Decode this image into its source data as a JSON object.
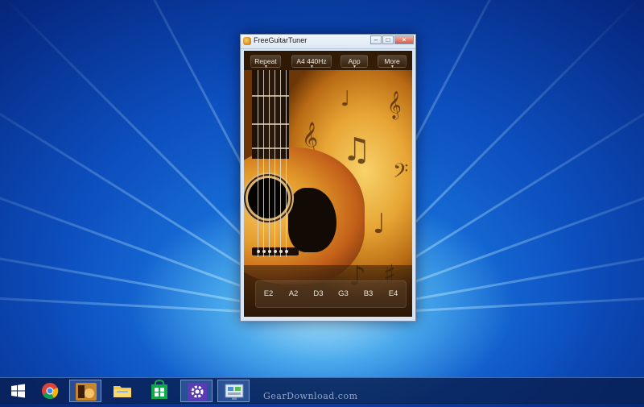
{
  "window": {
    "title": "FreeGuitarTuner"
  },
  "toolbar": {
    "repeat": "Repeat",
    "pitch": "A4 440Hz",
    "app": "App",
    "more": "More"
  },
  "strings": [
    "E2",
    "A2",
    "D3",
    "G3",
    "B3",
    "E4"
  ],
  "taskbar": {
    "items": [
      "start-icon",
      "chrome-icon",
      "guitar-tuner-icon",
      "file-explorer-icon",
      "store-icon",
      "settings-icon",
      "control-panel-icon"
    ]
  },
  "watermark": "GearDownload.com",
  "colors": {
    "desktop": "#0d4fbf",
    "taskbar": "#081e50",
    "close": "#d65c45"
  }
}
